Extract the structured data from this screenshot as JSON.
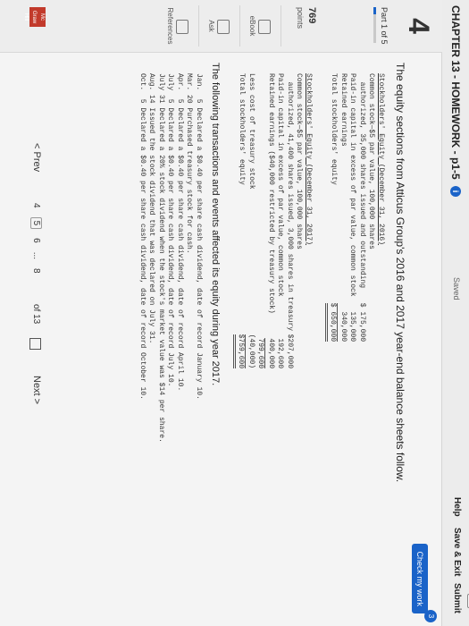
{
  "header": {
    "title": "CHAPTER 13 - HOMEWORK - p1-5",
    "info_glyph": "i",
    "saved": "Saved",
    "help": "Help",
    "save_exit": "Save & Exit",
    "submit": "Submit"
  },
  "rail": {
    "question_number": "4",
    "part": "Part 1 of 5",
    "part_progress": 0.2,
    "points": "769",
    "points_label": "points",
    "links": [
      "eBook",
      "Ask",
      "References"
    ]
  },
  "check_my_work": {
    "label": "Check my work",
    "badge": "3"
  },
  "prompt": "The equity sections from Atticus Group's 2016 and 2017 year-end balance sheets follow.",
  "equity_2016": {
    "heading": "Stockholders' Equity (December 31, 2016)",
    "rows": [
      {
        "label": "Common stock—$5 par value, 100,000 shares",
        "amount": ""
      },
      {
        "label": "  authorized, 35,000 shares issued and outstanding",
        "amount": "$ 175,000"
      },
      {
        "label": "Paid-in capital in excess of par value, common stock",
        "amount": "135,000"
      },
      {
        "label": "Retained earnings",
        "amount": "340,000"
      },
      {
        "label": "Total stockholders' equity",
        "amount": "$ 650,000"
      }
    ]
  },
  "equity_2017": {
    "heading": "Stockholders' Equity (December 31, 2017)",
    "rows": [
      {
        "label": "Common stock—$5 par value, 100,000 shares",
        "amount": ""
      },
      {
        "label": "  authorized, 41,400 shares issued, 3,000 shares in treasury",
        "amount": "$207,000"
      },
      {
        "label": "Paid-in capital in excess of par value, common stock",
        "amount": "192,600"
      },
      {
        "label": "Retained earnings ($40,000 restricted by treasury stock)",
        "amount": "400,000"
      },
      {
        "label": "",
        "amount": "799,600"
      },
      {
        "label": "Less cost of treasury stock",
        "amount": "(40,000)"
      },
      {
        "label": "Total stockholders' equity",
        "amount": "$759,600"
      }
    ]
  },
  "transactions": {
    "intro": "The following transactions and events affected its equity during year 2017.",
    "lines": [
      "Jan.  5 Declared a $0.40 per share cash dividend, date of record January 10.",
      "Mar. 20 Purchased treasury stock for cash.",
      "Apr.  5 Declared a $0.40 per share cash dividend, date of record April 10.",
      "July  5 Declared a $0.40 per share cash dividend, date of record July 10.",
      "July 31 Declared a 20% stock dividend when the stock's market value was $14 per share.",
      "Aug. 14 Issued the stock dividend that was declared on July 31.",
      "Oct.  5 Declared a $0.40 per share cash dividend, date of record October 10."
    ]
  },
  "pager": {
    "prev": "< Prev",
    "pages": [
      "4",
      "5",
      "6",
      "...",
      "8"
    ],
    "current_index": 1,
    "of_label": "of 13",
    "next": "Next >",
    "logo": "Mc Graw Hill"
  }
}
